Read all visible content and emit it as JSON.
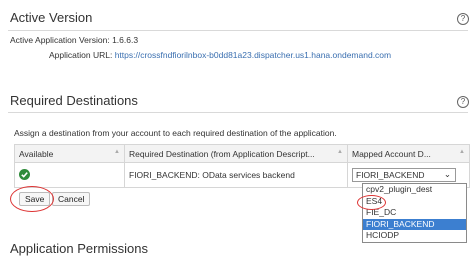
{
  "active_version": {
    "title": "Active Version",
    "version_label": "Active Application Version:",
    "version_value": "1.6.6.3",
    "url_label": "Application URL:",
    "url_value": "https://crossfndfiorilnbox-b0dd81a23.dispatcher.us1.hana.ondemand.com"
  },
  "required_destinations": {
    "title": "Required Destinations",
    "instruction": "Assign a destination from your account to each required destination of the application.",
    "columns": [
      "Available",
      "Required Destination (from Application Descript...",
      "Mapped Account D..."
    ],
    "rows": [
      {
        "available": "ok",
        "required": "FIORI_BACKEND: OData services backend",
        "mapped": "FIORI_BACKEND"
      }
    ],
    "dropdown_options": [
      "cpv2_plugin_dest",
      "ES4",
      "FIE_DC",
      "FIORI_BACKEND",
      "HCIODP"
    ],
    "selected_option": "FIORI_BACKEND",
    "save_label": "Save",
    "cancel_label": "Cancel"
  },
  "app_permissions": {
    "title": "Application Permissions"
  },
  "icons": {
    "help": "help-icon",
    "ok": "check-circle-icon",
    "dropdown": "chevron-down-icon"
  },
  "colors": {
    "accent": "#3c7fd0",
    "ok": "#2e8b3a",
    "annotation": "#d33333",
    "link": "#3a6fb0"
  }
}
